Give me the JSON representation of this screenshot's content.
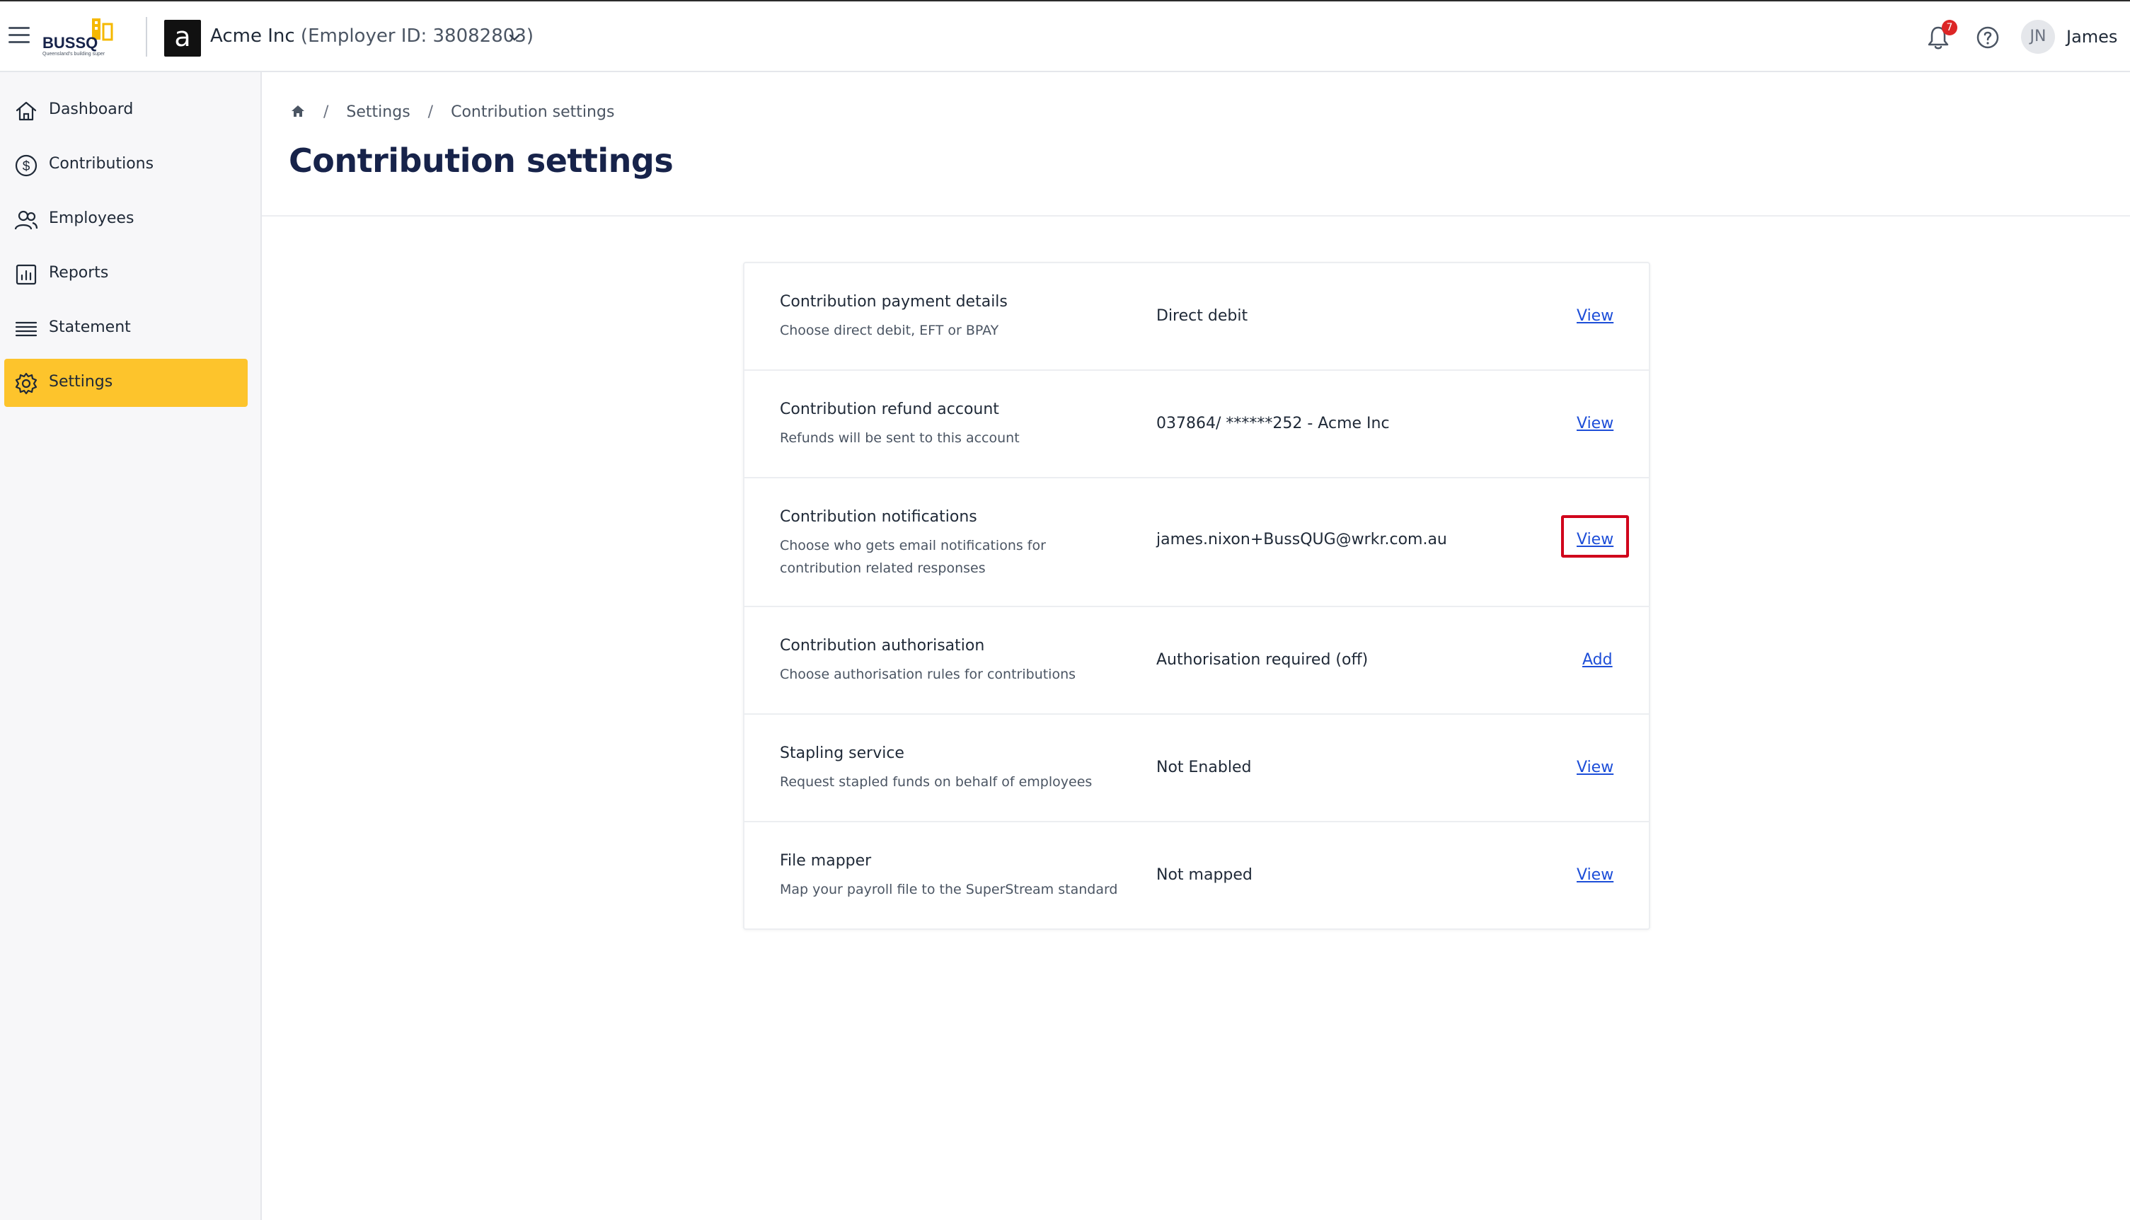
{
  "topbar": {
    "logo_text": "BUSSQ",
    "logo_tagline": "Queensland's building super",
    "org_avatar_letter": "a",
    "org_name": "Acme Inc",
    "org_employer_id": "(Employer ID: 38082803)",
    "notification_count": "7",
    "user_initials": "JN",
    "user_name": "James"
  },
  "sidebar": {
    "items": [
      {
        "label": "Dashboard",
        "icon": "home-icon"
      },
      {
        "label": "Contributions",
        "icon": "dollar-icon"
      },
      {
        "label": "Employees",
        "icon": "users-icon"
      },
      {
        "label": "Reports",
        "icon": "report-icon"
      },
      {
        "label": "Statement",
        "icon": "list-icon"
      },
      {
        "label": "Settings",
        "icon": "gear-icon",
        "active": true
      }
    ]
  },
  "breadcrumb": {
    "items": [
      "Settings",
      "Contribution settings"
    ]
  },
  "page_title": "Contribution settings",
  "settings": {
    "rows": [
      {
        "title": "Contribution payment details",
        "desc": "Choose direct debit, EFT or BPAY",
        "value": "Direct debit",
        "action": "View"
      },
      {
        "title": "Contribution refund account",
        "desc": "Refunds will be sent to this account",
        "value": "037864/ ******252 - Acme Inc",
        "action": "View"
      },
      {
        "title": "Contribution notifications",
        "desc": "Choose who gets email notifications for contribution related responses",
        "value": "james.nixon+BussQUG@wrkr.com.au",
        "action": "View"
      },
      {
        "title": "Contribution authorisation",
        "desc": "Choose authorisation rules for contributions",
        "value": "Authorisation required (off)",
        "action": "Add"
      },
      {
        "title": "Stapling service",
        "desc": "Request stapled funds on behalf of employees",
        "value": "Not Enabled",
        "action": "View"
      },
      {
        "title": "File mapper",
        "desc": "Map your payroll file to the SuperStream standard",
        "value": "Not mapped",
        "action": "View"
      }
    ]
  },
  "colors": {
    "accent": "#fdc42c",
    "title": "#17234a",
    "link": "#1d4ed8",
    "highlight": "#d0021b"
  }
}
